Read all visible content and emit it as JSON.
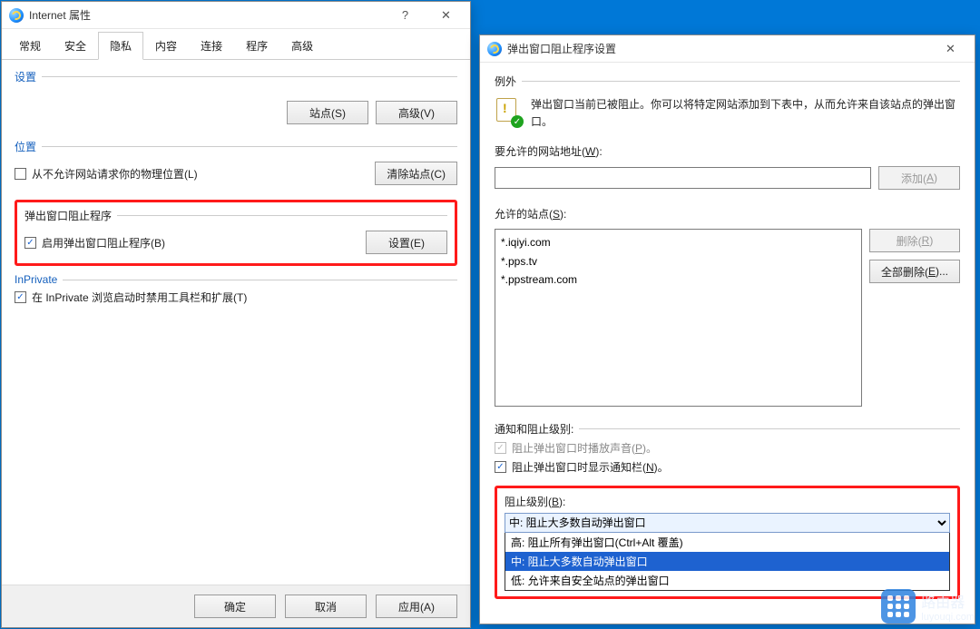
{
  "left_window": {
    "title": "Internet 属性",
    "tabs": [
      "常规",
      "安全",
      "隐私",
      "内容",
      "连接",
      "程序",
      "高级"
    ],
    "active_tab_index": 2,
    "settings_group": {
      "title": "设置",
      "site_button": "站点(S)",
      "advanced_button": "高级(V)"
    },
    "location_group": {
      "title": "位置",
      "checkbox_label": "从不允许网站请求你的物理位置(L)",
      "checkbox_checked": false,
      "clear_button": "清除站点(C)"
    },
    "popup_group": {
      "title": "弹出窗口阻止程序",
      "checkbox_label": "启用弹出窗口阻止程序(B)",
      "checkbox_checked": true,
      "settings_button": "设置(E)"
    },
    "inprivate_group": {
      "title": "InPrivate",
      "checkbox_label": "在 InPrivate 浏览启动时禁用工具栏和扩展(T)",
      "checkbox_checked": true
    },
    "footer": {
      "ok": "确定",
      "cancel": "取消",
      "apply": "应用(A)"
    }
  },
  "right_window": {
    "title": "弹出窗口阻止程序设置",
    "exception_group": "例外",
    "exception_note": "弹出窗口当前已被阻止。你可以将特定网站添加到下表中，从而允许来自该站点的弹出窗口。",
    "address_label": "要允许的网站地址(W):",
    "address_value": "",
    "add_button": "添加(A)",
    "allowed_label": "允许的站点(S):",
    "allowed_sites": [
      "*.iqiyi.com",
      "*.pps.tv",
      "*.ppstream.com"
    ],
    "remove_button": "删除(R)",
    "remove_all_button": "全部删除(E)...",
    "notify_group": "通知和阻止级别:",
    "sound_checkbox": "阻止弹出窗口时播放声音(P)。",
    "sound_checked": true,
    "bar_checkbox": "阻止弹出窗口时显示通知栏(N)。",
    "bar_checked": true,
    "level_label": "阻止级别(B):",
    "level_selected": "中: 阻止大多数自动弹出窗口",
    "level_options": [
      "高: 阻止所有弹出窗口(Ctrl+Alt 覆盖)",
      "中: 阻止大多数自动弹出窗口",
      "低: 允许来自安全站点的弹出窗口"
    ]
  },
  "watermark": {
    "brand": "路由器",
    "domain": "luyouqi.com"
  }
}
